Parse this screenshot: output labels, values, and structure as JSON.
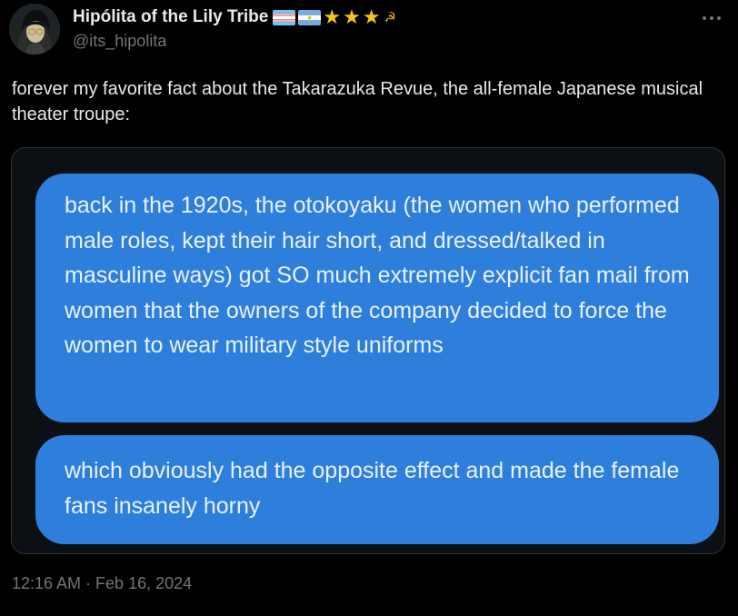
{
  "author": {
    "display_name": "Hipólita of the Lily Tribe",
    "handle": "@its_hipolita",
    "badges": [
      "transgender-flag",
      "argentina-flag",
      "star",
      "star",
      "star",
      "hammer-and-sickle"
    ]
  },
  "tweet": {
    "text": "forever my favorite fact about the Takarazuka Revue, the all-female Japanese musical theater troupe:",
    "timestamp": "12:16 AM · Feb 16, 2024"
  },
  "media": {
    "bubbles": [
      "back in the 1920s, the otokoyaku (the women who performed male roles, kept their hair short, and dressed/talked in masculine ways) got SO much extremely explicit fan mail from women that the owners of the company decided to force the women to wear military style uniforms",
      "which obviously had the opposite effect and made the female fans insanely horny"
    ]
  },
  "colors": {
    "background": "#000000",
    "text_primary": "#e7e9ea",
    "text_secondary": "#71767b",
    "bubble": "#2e7fdc",
    "star": "#f5c518"
  },
  "icons": {
    "more": "more-horizontal-icon"
  }
}
